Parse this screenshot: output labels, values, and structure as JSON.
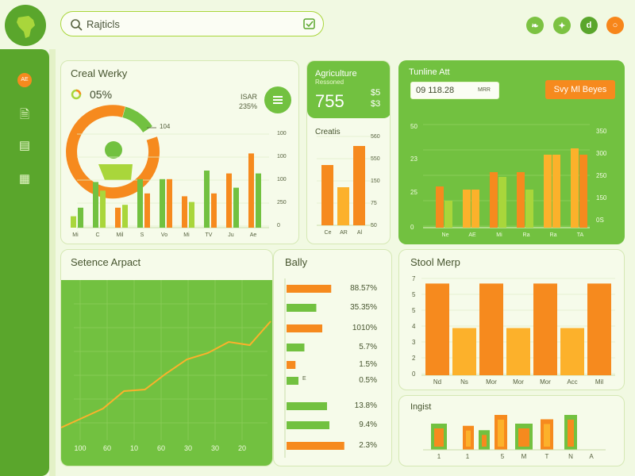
{
  "search": {
    "value": "Rajticls"
  },
  "sidebar": {
    "badge_label": "AE"
  },
  "social": [
    {
      "name": "leaf-icon",
      "glyph": "❧",
      "color": "#7cc242"
    },
    {
      "name": "twitter-icon",
      "glyph": "✦",
      "color": "#7cc242"
    },
    {
      "name": "d-icon",
      "glyph": "d",
      "color": "#5aa62c"
    },
    {
      "name": "ring-icon",
      "glyph": "○",
      "color": "#f7861a"
    }
  ],
  "colors": {
    "green": "#72c140",
    "dark_green": "#5aa62c",
    "orange": "#f68a1e",
    "yellow": "#fcb12b",
    "lime": "#a9d63b"
  },
  "card1": {
    "title": "Creal Werky",
    "percent": "05%",
    "stat_top": "ISAR",
    "stat_bottom": "235%",
    "donut_callout": "104",
    "donut_values": [
      45,
      25,
      30
    ],
    "y_ticks": [
      "100",
      "100",
      "100",
      "250",
      "0"
    ],
    "x_labels": [
      "Mi",
      "C",
      "Mil",
      "S",
      "Vo",
      "Mi",
      "TV",
      "Ju",
      "Ae"
    ]
  },
  "card2": {
    "title": "Agriculture",
    "subtitle": "Ressoned",
    "big_value": "755",
    "side_top": "$5",
    "side_bottom": "$3",
    "chart_title": "Creatis",
    "y_ticks": [
      "560",
      "550",
      "150",
      "75",
      "50"
    ],
    "x_labels": [
      "Ce",
      "AR",
      "Al"
    ]
  },
  "card3": {
    "title": "Tunline Att",
    "date_value": "09 118.28",
    "date_extra": "MRR",
    "button_label": "Svy Ml Beyes",
    "y_left": [
      "50",
      "23",
      "25",
      "0"
    ],
    "y_right": [
      "350",
      "300",
      "250",
      "150",
      "0S"
    ],
    "x_labels": [
      "Ne",
      "AE",
      "Mi",
      "Ra",
      "Ra",
      "TA"
    ]
  },
  "card4": {
    "title": "Setence Arpact",
    "x_labels": [
      "100",
      "60",
      "10",
      "60",
      "30",
      "30",
      "20"
    ]
  },
  "card5": {
    "title": "Bally",
    "bar_labels": [
      "88.57%",
      "35.35%",
      "1010%",
      "5.7%",
      "1.5%",
      "0.5%",
      "13.8%",
      "9.4%",
      "2.3%"
    ],
    "small_label": "E"
  },
  "card6": {
    "title": "Stool Merp",
    "y_ticks": [
      "7",
      "5",
      "5",
      "4",
      "3",
      "2",
      "0"
    ],
    "x_labels": [
      "Nd",
      "Ns",
      "Mor",
      "Mor",
      "Mor",
      "Acc",
      "Mil"
    ]
  },
  "card7": {
    "title": "Ingist",
    "x_labels": [
      "1",
      "1",
      "5",
      "M",
      "T",
      "N",
      "A"
    ]
  },
  "chart_data": [
    {
      "type": "bar",
      "title": "Creal Werky",
      "categories": [
        "Mi",
        "C",
        "Mil",
        "S",
        "Vo",
        "Mi",
        "TV",
        "Ju",
        "Ae"
      ],
      "series": [
        {
          "values": [
            20,
            80,
            35,
            85,
            85,
            55,
            100,
            95,
            130
          ]
        },
        {
          "values": [
            35,
            65,
            40,
            60,
            85,
            45,
            60,
            70,
            95
          ]
        }
      ]
    },
    {
      "type": "bar",
      "title": "Creatis",
      "categories": [
        "Ce",
        "AR",
        "Al"
      ],
      "values": [
        380,
        240,
        500
      ]
    },
    {
      "type": "bar",
      "title": "Tunline Att",
      "categories": [
        "Ne",
        "AE",
        "Mi",
        "Ra",
        "Ra",
        "TA"
      ],
      "series": [
        {
          "values": [
            26,
            24,
            35,
            35,
            46,
            50
          ]
        },
        {
          "values": [
            17,
            24,
            32,
            24,
            46,
            46
          ]
        }
      ]
    },
    {
      "type": "line",
      "title": "Setence Arpact",
      "x": [
        "100",
        "60",
        "10",
        "60",
        "30",
        "30",
        "20"
      ],
      "values": [
        18,
        24,
        30,
        41,
        42,
        52,
        61,
        65,
        72,
        70,
        85
      ]
    },
    {
      "type": "bar",
      "title": "Bally",
      "categories": [
        "88.57%",
        "35.35%",
        "1010%",
        "5.7%",
        "1.5%",
        "0.5%",
        "13.8%",
        "9.4%",
        "2.3%"
      ],
      "values": [
        75,
        50,
        60,
        30,
        15,
        20,
        68,
        72,
        97
      ]
    },
    {
      "type": "bar",
      "title": "Stool Merp",
      "categories": [
        "Nd",
        "Ns",
        "Mor",
        "Mor",
        "Mor",
        "Acc",
        "Mil"
      ],
      "values": [
        6.8,
        3.5,
        6.8,
        3.5,
        6.8,
        3.5,
        6.8
      ]
    },
    {
      "type": "bar",
      "title": "Ingist",
      "categories": [
        "1",
        "1",
        "5",
        "M",
        "T",
        "N",
        "A"
      ],
      "values": [
        60,
        55,
        45,
        80,
        60,
        70,
        80
      ]
    }
  ]
}
